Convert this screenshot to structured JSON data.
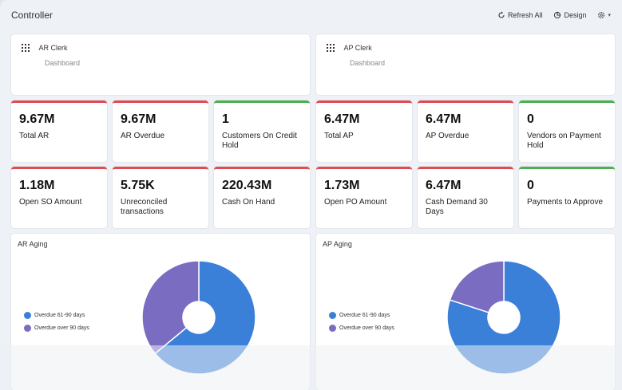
{
  "app": {
    "title": "Controller"
  },
  "toolbar": {
    "refresh_label": "Refresh All",
    "design_label": "Design"
  },
  "user_cards": [
    {
      "name": "AR Clerk",
      "sub": "Dashboard"
    },
    {
      "name": "AP Clerk",
      "sub": "Dashboard"
    }
  ],
  "kpis": [
    {
      "value": "9.67M",
      "label": "Total AR",
      "status": "red"
    },
    {
      "value": "9.67M",
      "label": "AR Overdue",
      "status": "red"
    },
    {
      "value": "1",
      "label": "Customers On Credit Hold",
      "status": "green"
    },
    {
      "value": "6.47M",
      "label": "Total AP",
      "status": "red"
    },
    {
      "value": "6.47M",
      "label": "AP Overdue",
      "status": "red"
    },
    {
      "value": "0",
      "label": "Vendors on Payment Hold",
      "status": "green"
    },
    {
      "value": "1.18M",
      "label": "Open SO Amount",
      "status": "red"
    },
    {
      "value": "5.75K",
      "label": "Unreconciled transactions",
      "status": "red"
    },
    {
      "value": "220.43M",
      "label": "Cash On Hand",
      "status": "red"
    },
    {
      "value": "1.73M",
      "label": "Open PO Amount",
      "status": "red"
    },
    {
      "value": "6.47M",
      "label": "Cash Demand 30 Days",
      "status": "red"
    },
    {
      "value": "0",
      "label": "Payments to Approve",
      "status": "green"
    }
  ],
  "colors": {
    "red": "#e04b52",
    "green": "#4caf50",
    "blue": "#3a7fd8",
    "purple": "#7a6cc0"
  },
  "icons": [
    "refresh-icon",
    "design-icon",
    "settings-icon",
    "grid-icon"
  ],
  "chart_data": [
    {
      "type": "pie",
      "title": "AR Aging",
      "categories": [
        "Overdue 61-90 days",
        "Overdue over 90 days"
      ],
      "values": [
        64,
        36
      ],
      "colors": [
        "#3a7fd8",
        "#7a6cc0"
      ],
      "legend": "left"
    },
    {
      "type": "pie",
      "title": "AP Aging",
      "categories": [
        "Overdue 61-90 days",
        "Overdue over 90 days"
      ],
      "values": [
        80,
        20
      ],
      "colors": [
        "#3a7fd8",
        "#7a6cc0"
      ],
      "legend": "left"
    }
  ]
}
